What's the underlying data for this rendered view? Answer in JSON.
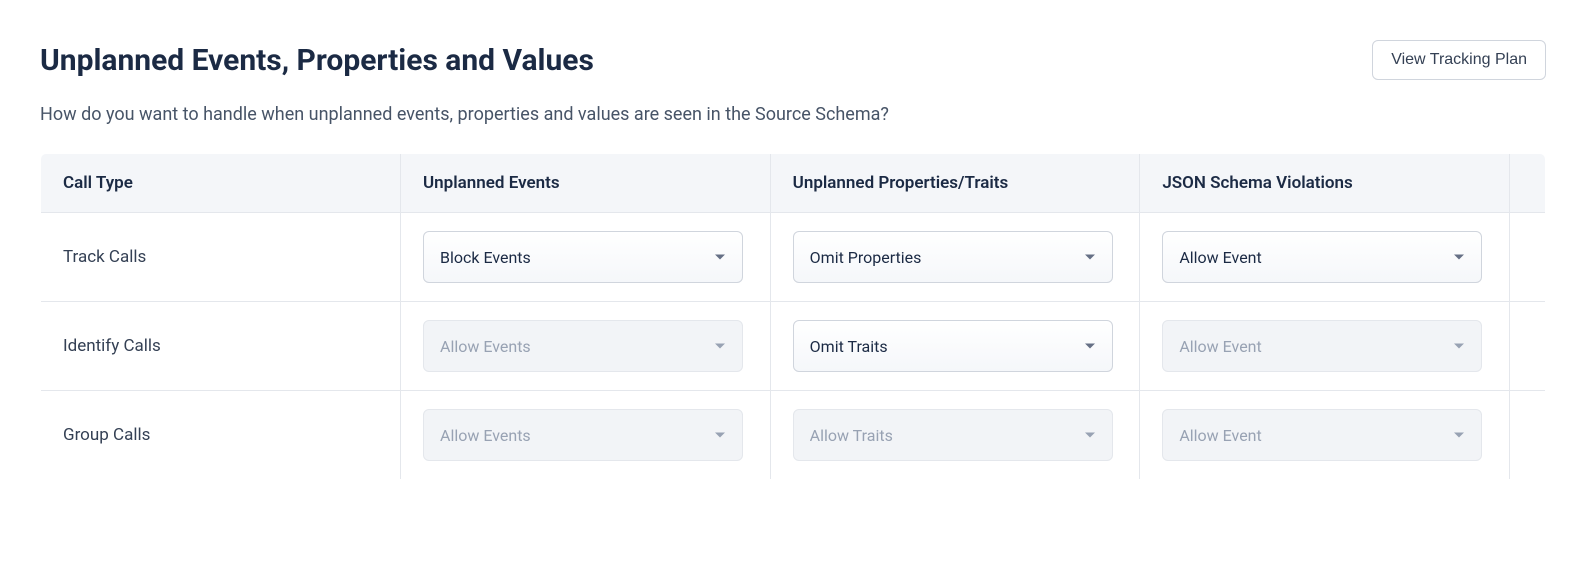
{
  "header": {
    "title": "Unplanned Events, Properties and Values",
    "view_plan_button": "View Tracking Plan"
  },
  "description": "How do you want to handle when unplanned events, properties and values are seen in the Source Schema?",
  "table": {
    "columns": {
      "call_type": "Call Type",
      "unplanned_events": "Unplanned Events",
      "unplanned_properties_traits": "Unplanned Properties/Traits",
      "json_schema_violations": "JSON Schema Violations"
    },
    "rows": [
      {
        "call_type": "Track Calls",
        "unplanned_events": {
          "value": "Block Events",
          "enabled": true
        },
        "unplanned_properties_traits": {
          "value": "Omit Properties",
          "enabled": true
        },
        "json_schema_violations": {
          "value": "Allow Event",
          "enabled": true
        }
      },
      {
        "call_type": "Identify Calls",
        "unplanned_events": {
          "value": "Allow Events",
          "enabled": false
        },
        "unplanned_properties_traits": {
          "value": "Omit Traits",
          "enabled": true
        },
        "json_schema_violations": {
          "value": "Allow Event",
          "enabled": false
        }
      },
      {
        "call_type": "Group Calls",
        "unplanned_events": {
          "value": "Allow Events",
          "enabled": false
        },
        "unplanned_properties_traits": {
          "value": "Allow Traits",
          "enabled": false
        },
        "json_schema_violations": {
          "value": "Allow Event",
          "enabled": false
        }
      }
    ]
  }
}
